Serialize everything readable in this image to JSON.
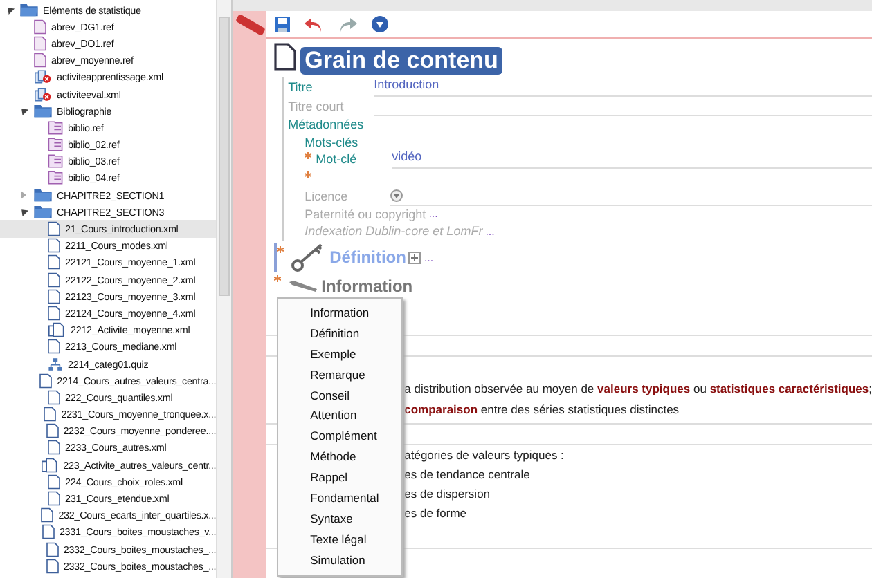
{
  "tree": [
    {
      "label": "Eléments de statistique",
      "kind": "folder",
      "expanded": true,
      "selected": false,
      "children": [
        {
          "label": "abrev_DG1.ref",
          "kind": "ref",
          "selected": false
        },
        {
          "label": "abrev_DO1.ref",
          "kind": "ref",
          "selected": false
        },
        {
          "label": "abrev_moyenne.ref",
          "kind": "ref",
          "selected": false
        },
        {
          "label": "activiteapprentissage.xml",
          "kind": "error",
          "selected": false
        },
        {
          "label": "activiteeval.xml",
          "kind": "error",
          "selected": false
        },
        {
          "label": "Bibliographie",
          "kind": "folder",
          "expanded": true,
          "selected": false,
          "children": [
            {
              "label": "biblio.ref",
              "kind": "biblio",
              "selected": false
            },
            {
              "label": "biblio_02.ref",
              "kind": "biblio",
              "selected": false
            },
            {
              "label": "biblio_03.ref",
              "kind": "biblio",
              "selected": false
            },
            {
              "label": "biblio_04.ref",
              "kind": "biblio",
              "selected": false
            }
          ]
        },
        {
          "label": "CHAPITRE2_SECTION1",
          "kind": "folder",
          "expanded": false,
          "selected": false
        },
        {
          "label": "CHAPITRE2_SECTION3",
          "kind": "folder",
          "expanded": true,
          "selected": false,
          "children": [
            {
              "label": "21_Cours_introduction.xml",
              "kind": "file",
              "selected": true
            },
            {
              "label": "2211_Cours_modes.xml",
              "kind": "file",
              "selected": false
            },
            {
              "label": "22121_Cours_moyenne_1.xml",
              "kind": "file",
              "selected": false
            },
            {
              "label": "22122_Cours_moyenne_2.xml",
              "kind": "file",
              "selected": false
            },
            {
              "label": "22123_Cours_moyenne_3.xml",
              "kind": "file",
              "selected": false
            },
            {
              "label": "22124_Cours_moyenne_4.xml",
              "kind": "file",
              "selected": false
            },
            {
              "label": "2212_Activite_moyenne.xml",
              "kind": "activity",
              "selected": false
            },
            {
              "label": "2213_Cours_mediane.xml",
              "kind": "file",
              "selected": false
            },
            {
              "label": "2214_categ01.quiz",
              "kind": "quiz",
              "selected": false
            },
            {
              "label": "2214_Cours_autres_valeurs_centra...",
              "kind": "file",
              "selected": false
            },
            {
              "label": "222_Cours_quantiles.xml",
              "kind": "file",
              "selected": false
            },
            {
              "label": "2231_Cours_moyenne_tronquee.x...",
              "kind": "file",
              "selected": false
            },
            {
              "label": "2232_Cours_moyenne_ponderee....",
              "kind": "file",
              "selected": false
            },
            {
              "label": "2233_Cours_autres.xml",
              "kind": "file",
              "selected": false
            },
            {
              "label": "223_Activite_autres_valeurs_centr...",
              "kind": "activity",
              "selected": false
            },
            {
              "label": "224_Cours_choix_roles.xml",
              "kind": "file",
              "selected": false
            },
            {
              "label": "231_Cours_etendue.xml",
              "kind": "file",
              "selected": false
            },
            {
              "label": "232_Cours_ecarts_inter_quartiles.x...",
              "kind": "file",
              "selected": false
            },
            {
              "label": "2331_Cours_boites_moustaches_v...",
              "kind": "file",
              "selected": false
            },
            {
              "label": "2332_Cours_boites_moustaches_...",
              "kind": "file",
              "selected": false
            },
            {
              "label": "2332_Cours_boites_moustaches_...",
              "kind": "file",
              "selected": false
            }
          ]
        }
      ]
    }
  ],
  "editor": {
    "title": "Grain de contenu",
    "fields": [
      {
        "label": "Titre",
        "value": "Introduction",
        "required": true
      },
      {
        "label": "Titre court",
        "required": false
      }
    ],
    "metadata": {
      "label": "Métadonnées",
      "keywords_label": "Mots-clés",
      "keywords": [
        {
          "label": "Mot-clé",
          "value": "vidéo",
          "required": true
        },
        {
          "required": true
        }
      ],
      "licence": "Licence",
      "copyright": "Paternité ou copyright",
      "indexation": "Indexation Dublin-core et LomFr",
      "more": "..."
    },
    "sections": [
      {
        "kind": "definition",
        "label": "Définition",
        "more": "...",
        "required": true
      },
      {
        "kind": "information",
        "label": "Information",
        "required": true
      }
    ],
    "paragraphs": [
      {
        "lines": [
          "a distribution observée au moyen de **valeurs typiques** ou **statistiques caractéristiques**;",
          "**comparaison** entre des séries statistiques distinctes"
        ]
      },
      {
        "lines": [
          "atégories de valeurs typiques :",
          "es de tendance centrale",
          "es de dispersion",
          "es de forme"
        ]
      }
    ]
  },
  "menu": [
    "Information",
    "Définition",
    "Exemple",
    "Remarque",
    "Conseil",
    "Attention",
    "Complément",
    "Méthode",
    "Rappel",
    "Fondamental",
    "Syntaxe",
    "Texte légal",
    "Simulation"
  ]
}
